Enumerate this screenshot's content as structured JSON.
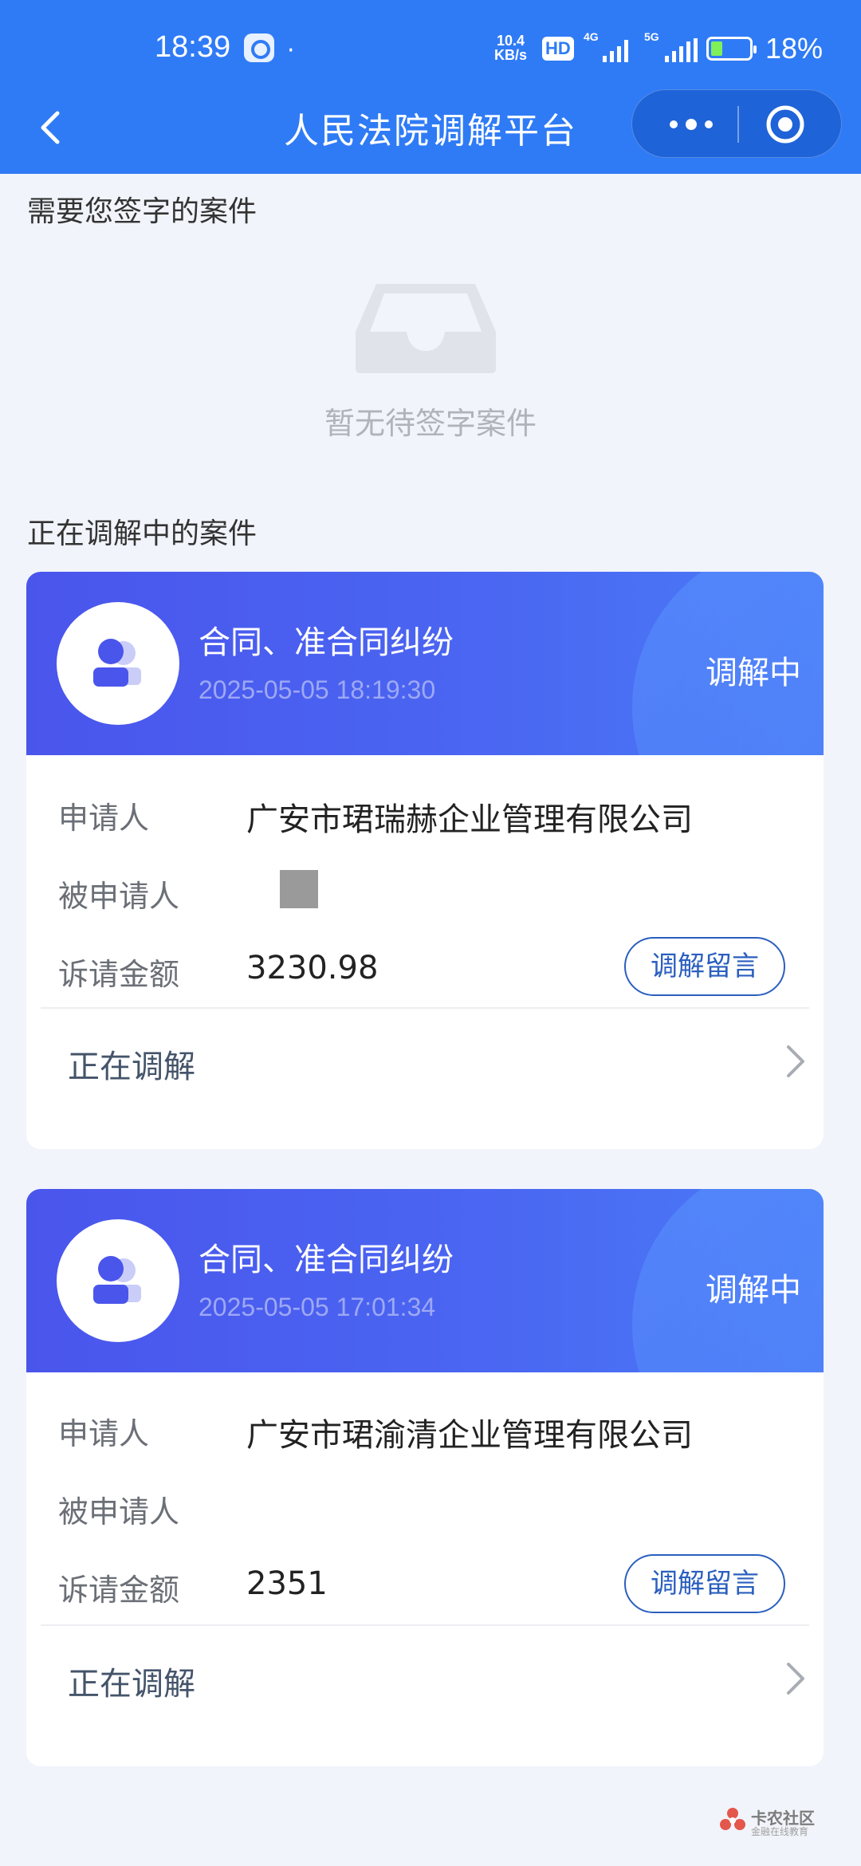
{
  "status_bar": {
    "time": "18:39",
    "dot": "·",
    "net_speed_value": "10.4",
    "net_speed_unit": "KB/s",
    "hd_label": "HD",
    "sim1": "4G",
    "sim2": "5G",
    "battery_percent": "18%"
  },
  "nav": {
    "title": "人民法院调解平台"
  },
  "pending_section": {
    "title": "需要您签字的案件",
    "empty_text": "暂无待签字案件"
  },
  "active_section": {
    "title": "正在调解中的案件"
  },
  "cases": [
    {
      "type": "合同、准合同纠纷",
      "time": "2025-05-05 18:19:30",
      "status": "调解中",
      "applicant_label": "申请人",
      "applicant": "广安市珺瑞赫企业管理有限公司",
      "respondent_label": "被申请人",
      "respondent": "",
      "amount_label": "诉请金额",
      "amount": "3230.98",
      "message_button": "调解留言",
      "progress": "正在调解"
    },
    {
      "type": "合同、准合同纠纷",
      "time": "2025-05-05 17:01:34",
      "status": "调解中",
      "applicant_label": "申请人",
      "applicant": "广安市珺渝清企业管理有限公司",
      "respondent_label": "被申请人",
      "respondent": "",
      "amount_label": "诉请金额",
      "amount": "2351",
      "message_button": "调解留言",
      "progress": "正在调解"
    }
  ],
  "watermark": {
    "text": "卡农社区",
    "sub": "金融在线教育"
  },
  "colors": {
    "topbar": "#2f7bf6",
    "card_header": "#4a55ec",
    "page_bg": "#f1f4fa",
    "button_border": "#2b5fbf"
  }
}
